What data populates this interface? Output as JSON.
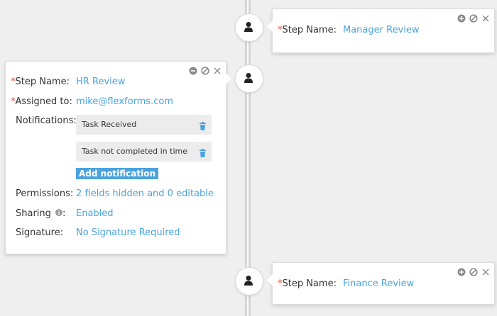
{
  "workflow": {
    "steps": [
      {
        "step_name_label": "Step Name:",
        "step_name": "Manager Review"
      },
      {
        "step_name_label": "Step Name:",
        "step_name": "HR Review",
        "assigned_label": "Assigned to:",
        "assigned_to": "mike@flexforms.com",
        "notifications_label": "Notifications:",
        "notifications": [
          {
            "label": "Task Received"
          },
          {
            "label": "Task not completed in time"
          }
        ],
        "add_notification_label": "Add notification",
        "permissions_label": "Permissions:",
        "permissions_value": "2 fields hidden and 0 editable",
        "sharing_label": "Sharing",
        "sharing_colon": ":",
        "sharing_value": "Enabled",
        "signature_label": "Signature:",
        "signature_value": "No Signature Required"
      },
      {
        "step_name_label": "Step Name:",
        "step_name": "Finance Review"
      }
    ],
    "required_marker": "*"
  },
  "colors": {
    "accent": "#4aa3df",
    "required": "#e94c3d",
    "background": "#efefef"
  },
  "icons": {
    "node": "user-icon",
    "controls": [
      "add-circle-icon",
      "disable-icon",
      "close-icon"
    ],
    "edit_controls": [
      "minus-circle-icon",
      "disable-icon",
      "close-icon"
    ],
    "delete": "trash-icon",
    "info": "info-icon"
  }
}
